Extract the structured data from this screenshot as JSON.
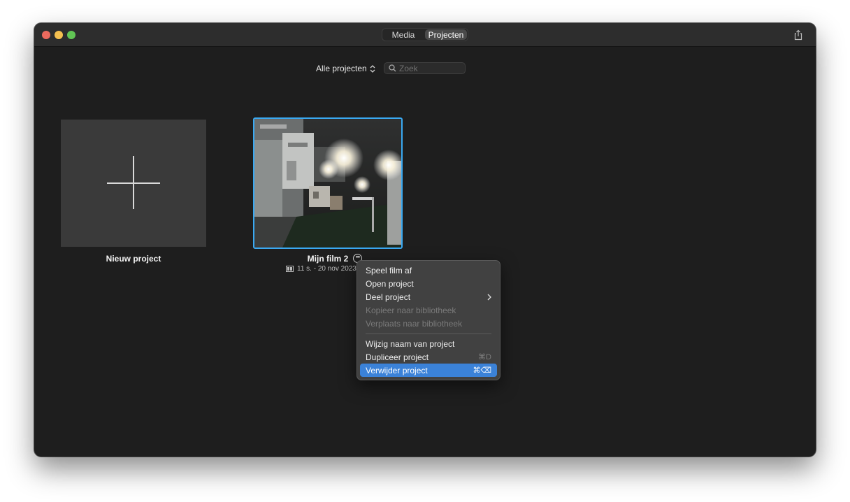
{
  "window": {
    "tabs": [
      "Media",
      "Projecten"
    ],
    "active_tab": "Projecten"
  },
  "toolbar": {
    "filter_label": "Alle projecten",
    "search_placeholder": "Zoek",
    "search_value": ""
  },
  "projects": {
    "new_project_label": "Nieuw project",
    "film": {
      "title": "Mijn film 2",
      "meta": "11 s. - 20 nov 2023"
    }
  },
  "context_menu": {
    "items": [
      {
        "label": "Speel film af",
        "shortcut": "",
        "enabled": true
      },
      {
        "label": "Open project",
        "shortcut": "",
        "enabled": true
      },
      {
        "label": "Deel project",
        "shortcut": "",
        "enabled": true,
        "submenu": true
      },
      {
        "label": "Kopieer naar bibliotheek",
        "shortcut": "",
        "enabled": false
      },
      {
        "label": "Verplaats naar bibliotheek",
        "shortcut": "",
        "enabled": false
      },
      {
        "label": "Wijzig naam van project",
        "shortcut": "",
        "enabled": true
      },
      {
        "label": "Dupliceer project",
        "shortcut": "⌘D",
        "enabled": true
      },
      {
        "label": "Verwijder project",
        "shortcut": "⌘⌫",
        "enabled": true,
        "highlighted": true
      }
    ]
  },
  "colors": {
    "selection_border": "#3aa9f2",
    "menu_highlight": "#3b82d8",
    "window_bg": "#1e1e1e"
  }
}
